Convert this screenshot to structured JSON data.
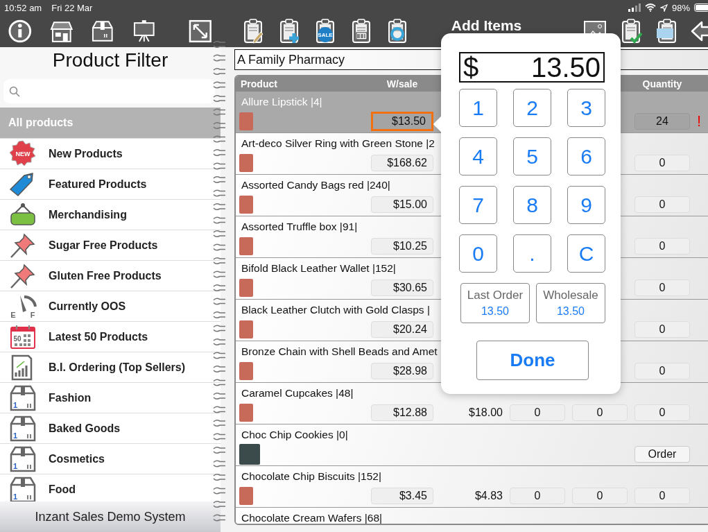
{
  "status_bar": {
    "time": "10:52 am",
    "date": "Fri 22 Mar",
    "battery": "98%"
  },
  "sidebar": {
    "toolbar": [
      {
        "kind": "info"
      },
      {
        "kind": "store"
      },
      {
        "kind": "box"
      },
      {
        "kind": "easel"
      },
      {
        "kind": "expand"
      }
    ],
    "title": "Product Filter",
    "items": [
      {
        "label": "All products",
        "selected": true
      },
      {
        "label": "New Products",
        "selected": false,
        "icon": {
          "kind": "new",
          "texts": [
            "NEW"
          ]
        }
      },
      {
        "label": "Featured Products",
        "selected": false,
        "icon": {
          "kind": "tag"
        }
      },
      {
        "label": "Merchandising",
        "selected": false,
        "icon": {
          "kind": "sign"
        }
      },
      {
        "label": "Sugar Free Products",
        "selected": false,
        "icon": {
          "kind": "pin"
        }
      },
      {
        "label": "Gluten Free Products",
        "selected": false,
        "icon": {
          "kind": "pin"
        }
      },
      {
        "label": "Currently OOS",
        "selected": false,
        "icon": {
          "kind": "gauge",
          "texts": [
            "E",
            "F"
          ]
        }
      },
      {
        "label": "Latest 50 Products",
        "selected": false,
        "icon": {
          "kind": "calendar",
          "texts": [
            "50"
          ]
        }
      },
      {
        "label": "B.I. Ordering (Top Sellers)",
        "selected": false,
        "icon": {
          "kind": "chart"
        }
      },
      {
        "label": "Fashion",
        "selected": false,
        "icon": {
          "kind": "box",
          "texts": [
            "1"
          ]
        }
      },
      {
        "label": "Baked Goods",
        "selected": false,
        "icon": {
          "kind": "box",
          "texts": [
            "1"
          ]
        }
      },
      {
        "label": "Cosmetics",
        "selected": false,
        "icon": {
          "kind": "box",
          "texts": [
            "1"
          ]
        }
      },
      {
        "label": "Food",
        "selected": false,
        "icon": {
          "kind": "box",
          "texts": [
            "1"
          ]
        }
      }
    ],
    "footer": "Inzant Sales Demo System"
  },
  "main": {
    "toolbar_left": [
      {
        "kind": "clip-pencil"
      },
      {
        "kind": "clip-plus"
      },
      {
        "kind": "clip-sale",
        "text": "SALE"
      },
      {
        "kind": "clip-barcode"
      },
      {
        "kind": "clip-sync"
      }
    ],
    "title": "Add Items",
    "toolbar_right": [
      {
        "kind": "picture"
      },
      {
        "kind": "clip-check"
      },
      {
        "kind": "clip-copy"
      },
      {
        "kind": "back-arrow"
      }
    ],
    "customer": "A Family Pharmacy",
    "table": {
      "columns": [
        "Product",
        "W/sale",
        "Quantity"
      ],
      "rows": [
        {
          "kind": "item",
          "name": "Allure Lipstick |4|",
          "selected": true,
          "editing": true,
          "wsale": "$13.50",
          "quantity": "24",
          "flag": "!"
        },
        {
          "kind": "item",
          "name": "Art-deco Silver Ring with Green Stone |2",
          "selected": false,
          "editing": false,
          "wsale": "$168.62",
          "quantity": "0"
        },
        {
          "kind": "item",
          "name": "Assorted Candy Bags red |240|",
          "selected": false,
          "editing": false,
          "wsale": "$15.00",
          "quantity": "0"
        },
        {
          "kind": "item",
          "name": "Assorted Truffle box |91|",
          "selected": false,
          "editing": false,
          "wsale": "$10.25",
          "quantity": "0"
        },
        {
          "kind": "item",
          "name": "Bifold Black Leather Wallet |152|",
          "selected": false,
          "editing": false,
          "wsale": "$30.65",
          "quantity": "0"
        },
        {
          "kind": "item",
          "name": "Black Leather Clutch with Gold Clasps |",
          "selected": false,
          "editing": false,
          "wsale": "$20.24",
          "quantity": "0"
        },
        {
          "kind": "item",
          "name": "Bronze Chain with Shell Beads and Amet",
          "selected": false,
          "editing": false,
          "wsale": "$28.98",
          "quantity": "0"
        },
        {
          "kind": "item",
          "name": "Caramel Cupcakes |48|",
          "selected": false,
          "editing": false,
          "wsale": "$12.88",
          "column_3": "$18.00",
          "column_4": "0",
          "column_5": "0",
          "quantity": "0"
        },
        {
          "kind": "order",
          "name": "Choc Chip Cookies |0|",
          "selected": false,
          "button": "Order"
        },
        {
          "kind": "item",
          "name": "Chocolate Chip Biscuits  |152|",
          "selected": false,
          "editing": false,
          "wsale": "$3.45",
          "column_3": "$4.83",
          "column_4": "0",
          "column_5": "0",
          "quantity": "0"
        },
        {
          "kind": "name_only",
          "name": "Chocolate Cream Wafers |68|",
          "selected": false
        }
      ]
    }
  },
  "keypad_popup": {
    "currency": "$",
    "value": "13.50",
    "keys": [
      "1",
      "2",
      "3",
      "4",
      "5",
      "6",
      "7",
      "8",
      "9",
      "0",
      ".",
      "C"
    ],
    "presets": [
      {
        "label": "Last Order",
        "value": "13.50"
      },
      {
        "label": "Wholesale",
        "value": "13.50"
      }
    ],
    "done": "Done"
  }
}
